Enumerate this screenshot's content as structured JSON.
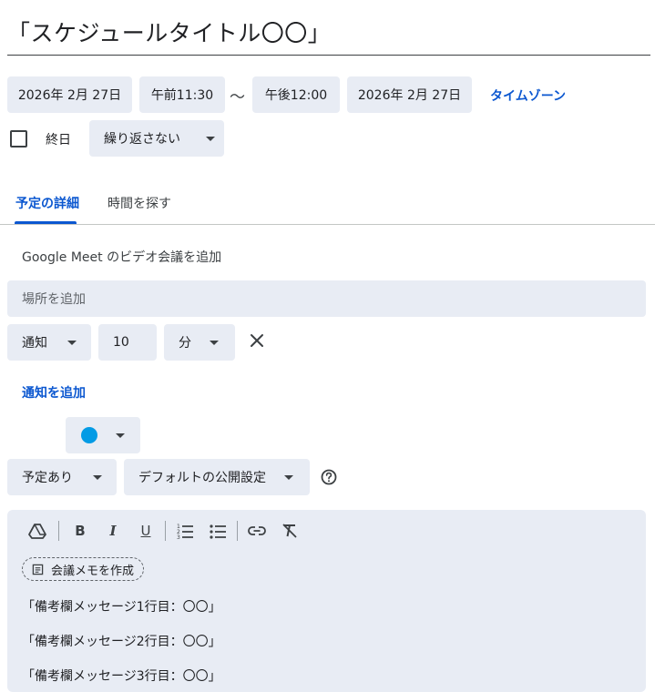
{
  "event": {
    "title": "「スケジュールタイトル〇〇」",
    "start_date": "2026年 2月 27日",
    "start_time": "午前11:30",
    "separator": "〜",
    "end_time": "午後12:00",
    "end_date": "2026年 2月 27日",
    "timezone_link": "タイムゾーン"
  },
  "all_day": {
    "label": "終日",
    "checked": false
  },
  "recurrence": {
    "selected": "繰り返さない"
  },
  "tabs": [
    {
      "label": "予定の詳細",
      "active": true
    },
    {
      "label": "時間を探す",
      "active": false
    }
  ],
  "details": {
    "meet_button": "Google Meet のビデオ会議を追加",
    "location_placeholder": "場所を追加",
    "notification": {
      "type": "通知",
      "value": "10",
      "unit": "分"
    },
    "add_notification": "通知を追加",
    "color": "#039be5",
    "availability": "予定あり",
    "visibility": "デフォルトの公開設定"
  },
  "editor": {
    "meeting_notes_chip": "会議メモを作成",
    "lines": [
      "「備考欄メッセージ1行目：〇〇」",
      "「備考欄メッセージ2行目：〇〇」",
      "「備考欄メッセージ3行目：〇〇」"
    ]
  },
  "toolbar_icons": [
    "drive-icon",
    "bold-icon",
    "italic-icon",
    "underline-icon",
    "numbered-list-icon",
    "bulleted-list-icon",
    "link-icon",
    "clear-formatting-icon"
  ]
}
